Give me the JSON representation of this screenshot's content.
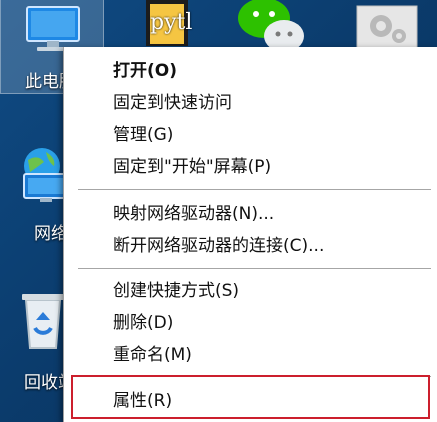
{
  "desktop": {
    "icons": [
      {
        "label": "此电脑",
        "visible_label": "此电脑"
      },
      {
        "label": "网络",
        "visible_label": "网络"
      },
      {
        "label": "回收站",
        "visible_label": "回收站"
      }
    ],
    "top_icons": [
      {
        "label": "Python",
        "visible_text": "pytl"
      },
      {
        "label": "WeChat"
      },
      {
        "label": "Settings"
      }
    ]
  },
  "context_menu": {
    "items": [
      {
        "label": "打开(O)"
      },
      {
        "label": "固定到快速访问"
      },
      {
        "label": "管理(G)"
      },
      {
        "label": "固定到\"开始\"屏幕(P)"
      },
      {
        "label": "映射网络驱动器(N)..."
      },
      {
        "label": "断开网络驱动器的连接(C)..."
      },
      {
        "label": "创建快捷方式(S)"
      },
      {
        "label": "删除(D)"
      },
      {
        "label": "重命名(M)"
      },
      {
        "label": "属性(R)"
      }
    ]
  },
  "colors": {
    "highlight_border": "#cc1f2d",
    "desktop_bg": "#0c3d6d"
  }
}
